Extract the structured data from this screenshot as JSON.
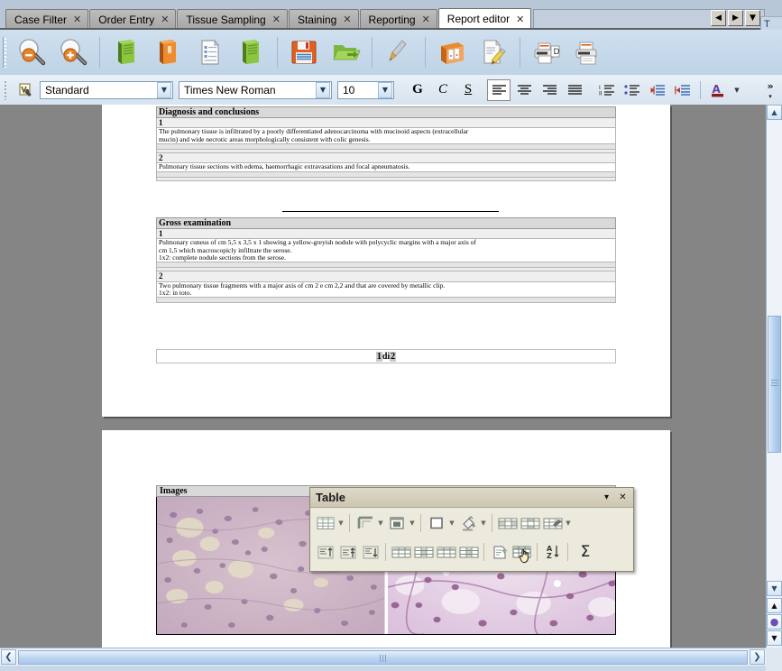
{
  "tabs": [
    {
      "label": "Case Filter",
      "active": false,
      "close": "✕"
    },
    {
      "label": "Order Entry",
      "active": false,
      "close": "✕"
    },
    {
      "label": "Tissue Sampling",
      "active": false,
      "close": "✕"
    },
    {
      "label": "Staining",
      "active": false,
      "close": "✕"
    },
    {
      "label": "Reporting",
      "active": false,
      "close": "✕"
    },
    {
      "label": "Report editor",
      "active": true,
      "close": "✕"
    }
  ],
  "tab_nav": {
    "prev": "◀",
    "next": "▶",
    "list": "▼"
  },
  "right_stub": {
    "title": "T",
    "field": "v"
  },
  "toolbar": {
    "buttons": [
      {
        "name": "zoom-out-icon",
        "tip": "Zoom Out"
      },
      {
        "name": "zoom-in-icon",
        "tip": "Zoom In"
      },
      {
        "name": "green-book-icon",
        "tip": "Open Report"
      },
      {
        "name": "orange-book-icon",
        "tip": "Close Report"
      },
      {
        "name": "document-list-icon",
        "tip": "New Document"
      },
      {
        "name": "green-book-2-icon",
        "tip": "Templates"
      },
      {
        "name": "save-floppy-icon",
        "tip": "Save"
      },
      {
        "name": "open-folder-icon",
        "tip": "Open"
      },
      {
        "name": "paintbrush-icon",
        "tip": "Format Paintbrush"
      },
      {
        "name": "archive-box-icon",
        "tip": "Archive"
      },
      {
        "name": "edit-document-icon",
        "tip": "Edit Document"
      },
      {
        "name": "print-preview-icon",
        "tip": "Print Preview"
      },
      {
        "name": "print-icon",
        "tip": "Print"
      }
    ]
  },
  "format_bar": {
    "style": {
      "value": "Standard",
      "placeholder": "Standard"
    },
    "font": {
      "value": "Times New Roman",
      "placeholder": "Times New Roman"
    },
    "size": {
      "value": "10",
      "placeholder": "10"
    },
    "bold_label": "G",
    "italic_label": "C",
    "underline_label": "S",
    "align_buttons": [
      {
        "name": "align-left-button",
        "active": true
      },
      {
        "name": "align-center-button",
        "active": false
      },
      {
        "name": "align-right-button",
        "active": false
      },
      {
        "name": "align-justify-button",
        "active": false
      }
    ],
    "list_buttons": [
      {
        "name": "ordered-list-button"
      },
      {
        "name": "unordered-list-button"
      },
      {
        "name": "decrease-indent-button"
      },
      {
        "name": "increase-indent-button"
      }
    ],
    "font_color": {
      "label": "A",
      "color": "#8b1a1a",
      "dropdown": "▼"
    },
    "overflow": "»",
    "overflow_down": "▾"
  },
  "document": {
    "page1": {
      "sections": [
        {
          "heading": "Diagnosis and conclusions",
          "items": [
            {
              "number": "1",
              "lines": [
                "The pulmonary tissue is infiltrated by a poorly differentiated adenocarcinoma with mucinoid aspects (extracellular",
                "mucin) and wide necrotic areas morphologically consistent with colic genesis."
              ]
            },
            {
              "number": "2",
              "lines": [
                "Pulmonary tissue sections with edema, haemorrhagic extravasations and focal apneumatosis."
              ]
            }
          ]
        },
        {
          "heading": "Gross examination",
          "items": [
            {
              "number": "1",
              "lines": [
                "Pulmonary cuneus of cm 5,5 x 3,5 x 1 showing a yellow-greyish nodule with polycyclic margins with a major axis of",
                "cm 1,5 which macroscopicly infiltrate the serose.",
                "1x2: complete nodule sections from the serose."
              ]
            },
            {
              "number": "2",
              "lines": [
                "Two pulmonary tissue fragments with a major axis of cm 2 e cm 2,2 and that are covered by metallic clip.",
                "1x2: in toto."
              ]
            }
          ]
        }
      ],
      "footer": {
        "prefix": "1",
        "middle": " di ",
        "suffix": "2"
      }
    },
    "page2": {
      "images_heading": "Images",
      "images": [
        {
          "name": "histology-image-left",
          "alt": "H&E stained pulmonary tissue, low power"
        },
        {
          "name": "histology-image-right",
          "alt": "H&E stained adenocarcinoma, high power"
        }
      ]
    }
  },
  "table_toolbar": {
    "title": "Table",
    "collapse": "▾",
    "close": "✕",
    "row1": [
      {
        "name": "insert-table-icon",
        "dropdown": true
      },
      {
        "name": "line-style-icon",
        "dropdown": true
      },
      {
        "name": "line-color-icon",
        "dropdown": true
      },
      {
        "name": "borders-icon",
        "dropdown": true
      },
      {
        "name": "background-color-icon",
        "dropdown": true
      },
      {
        "name": "merge-cells-icon",
        "dropdown": false
      },
      {
        "name": "split-cells-icon",
        "dropdown": false
      },
      {
        "name": "optimize-size-icon",
        "dropdown": true
      }
    ],
    "row2": [
      {
        "name": "align-top-icon"
      },
      {
        "name": "align-center-vertical-icon"
      },
      {
        "name": "align-bottom-icon"
      },
      {
        "name": "insert-row-icon"
      },
      {
        "name": "insert-column-icon"
      },
      {
        "name": "delete-row-icon"
      },
      {
        "name": "delete-column-icon"
      },
      {
        "name": "autoformat-icon"
      },
      {
        "name": "table-properties-icon"
      },
      {
        "name": "sort-icon"
      },
      {
        "name": "sum-icon",
        "label": "Σ"
      }
    ]
  },
  "scrollbars": {
    "v_up": "▲",
    "v_down": "▼",
    "prev_page": "▲",
    "nav_dot": "●",
    "next_page": "▼",
    "h_left": "❮",
    "h_right": "❯"
  },
  "colors": {
    "chrome": "#c9d8e8",
    "toolbar_top": "#cfe0ef",
    "doc_bg": "#858585",
    "table_toolbar": "#ece9dd",
    "accent": "#8b1a1a"
  }
}
